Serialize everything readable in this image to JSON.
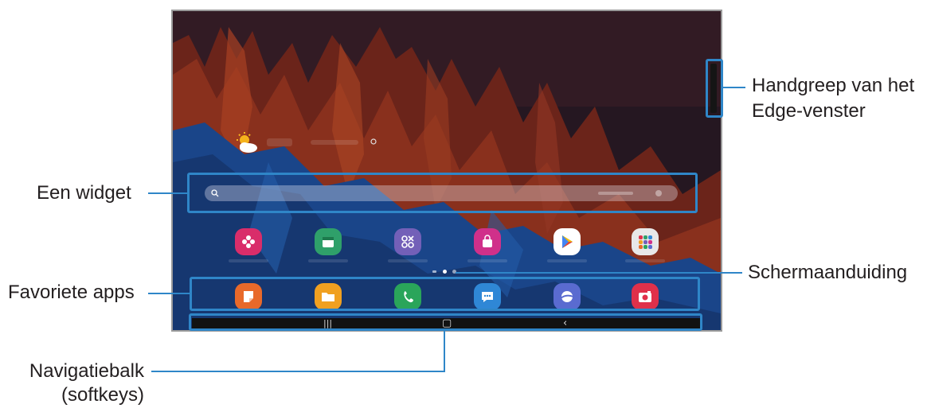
{
  "callouts": {
    "edge_handle": [
      "Handgreep van het",
      "Edge-venster"
    ],
    "widget": "Een widget",
    "favorite_apps": "Favoriete apps",
    "screen_indicator": "Schermaanduiding",
    "navigation_bar": [
      "Navigatiebalk",
      "(softkeys)"
    ]
  },
  "home_screen": {
    "weather_icon": "partly-cloudy-icon",
    "widget": {
      "icon": "search-icon"
    },
    "apps": [
      {
        "icon": "galaxy-store-flower-icon",
        "color": "#d92d6a"
      },
      {
        "icon": "calendar-icon",
        "color": "#2fa06a"
      },
      {
        "icon": "tools-icon",
        "color": "#7360b8"
      },
      {
        "icon": "galaxy-store-bag-icon",
        "color": "#d0308a"
      },
      {
        "icon": "play-store-icon",
        "color": "#ffffff"
      },
      {
        "icon": "folder-icon",
        "color": "#e8e8e8"
      }
    ],
    "page_indicator": {
      "pages": 3,
      "current": 2
    },
    "dock": [
      {
        "icon": "notes-icon",
        "color": "#e8692a"
      },
      {
        "icon": "my-files-icon",
        "color": "#f0a020"
      },
      {
        "icon": "phone-icon",
        "color": "#2aa55a"
      },
      {
        "icon": "messages-icon",
        "color": "#2f87d6"
      },
      {
        "icon": "internet-icon",
        "color": "#5a6bd0"
      },
      {
        "icon": "camera-icon",
        "color": "#e0304a"
      }
    ],
    "nav_bar": {
      "recent": "|||",
      "home": "▢",
      "back": "‹"
    }
  },
  "colors": {
    "highlight": "#2f86c8",
    "text": "#231f20",
    "frame": "#9a9a9a"
  }
}
